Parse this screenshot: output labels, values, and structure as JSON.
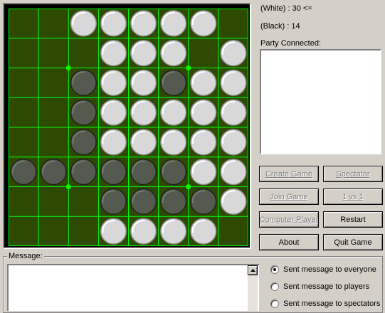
{
  "board": {
    "size": 8,
    "colors": {
      "board": "#2d4a00",
      "grid": "#00ff00",
      "white": "#d8d8d8",
      "black": "#555a50"
    },
    "cells": [
      "..WWWWW.",
      "...WWW.W",
      "..BWWBWW",
      "..BWWWWW",
      "..BWWWWW",
      "BBBBBBWW",
      "...BBBBW",
      "...WWWW."
    ],
    "star_points": [
      [
        2,
        2
      ],
      [
        2,
        6
      ],
      [
        6,
        2
      ],
      [
        6,
        6
      ]
    ]
  },
  "scores": {
    "white": "(White) : 30 <=",
    "black": "(Black) : 14"
  },
  "party": {
    "label": "Party Connected:",
    "items": []
  },
  "buttons": {
    "create_game": "Create Game",
    "spectator": "Spectator",
    "join_game": "Join Game",
    "one_vs_one": "1 vs 1",
    "computer_player": "Computer Player",
    "restart": "Restart",
    "about": "About",
    "quit_game": "Quit Game"
  },
  "message": {
    "label": "Message:",
    "text": "",
    "options": [
      {
        "label": "Sent message to everyone",
        "selected": true
      },
      {
        "label": "Sent message to players",
        "selected": false
      },
      {
        "label": "Sent message to spectators",
        "selected": false
      }
    ]
  }
}
